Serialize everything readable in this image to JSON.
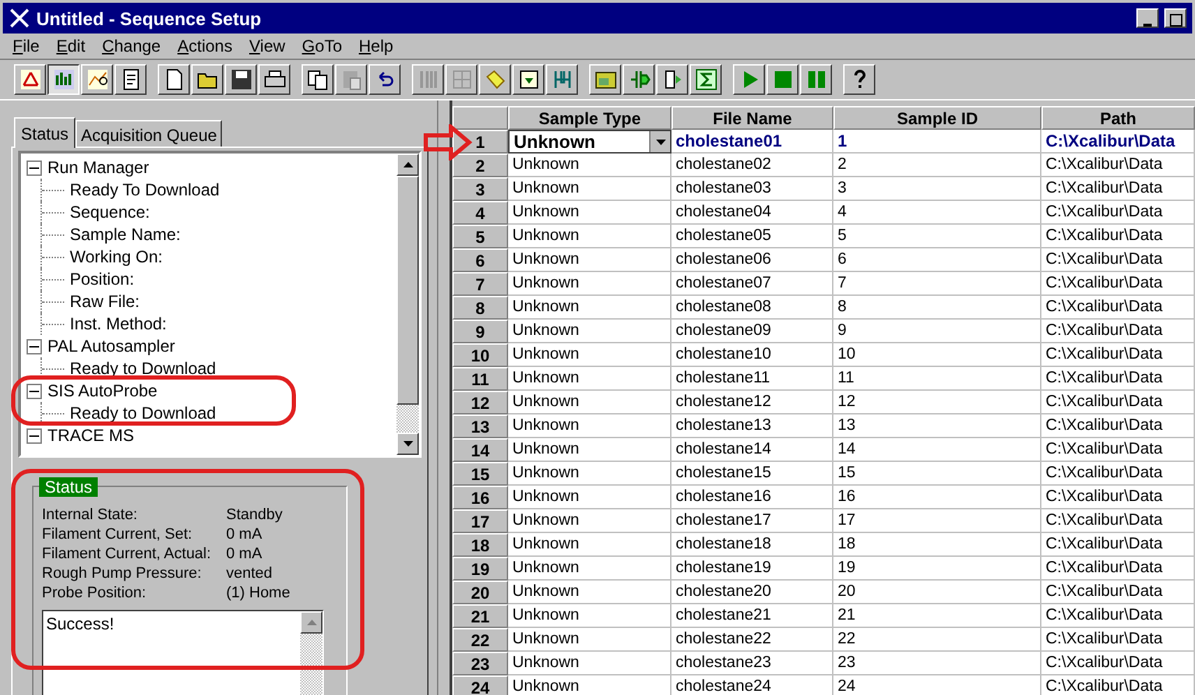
{
  "window": {
    "title": "Untitled - Sequence Setup"
  },
  "menu": [
    "File",
    "Edit",
    "Change",
    "Actions",
    "View",
    "GoTo",
    "Help"
  ],
  "toolbar": [
    [
      {
        "pressed": false
      },
      {
        "pressed": true
      },
      {
        "pressed": false
      },
      {
        "pressed": false
      }
    ],
    [
      {
        "disabled": false
      },
      {
        "disabled": false
      },
      {
        "disabled": false
      },
      {
        "disabled": false
      }
    ],
    [
      {
        "disabled": false
      },
      {
        "disabled": true
      },
      {
        "disabled": false
      }
    ],
    [
      {
        "disabled": true
      },
      {
        "disabled": true
      },
      {
        "disabled": false
      },
      {
        "disabled": false
      },
      {
        "disabled": false
      }
    ],
    [
      {
        "disabled": false
      },
      {
        "disabled": false
      },
      {
        "disabled": false
      },
      {
        "disabled": false
      }
    ],
    [
      {
        "disabled": false
      },
      {
        "disabled": false
      },
      {
        "disabled": false
      }
    ],
    [
      {
        "disabled": false
      }
    ]
  ],
  "tabs": [
    {
      "label": "Status",
      "selected": true
    },
    {
      "label": "Acquisition Queue",
      "selected": false
    }
  ],
  "tree": [
    {
      "label": "Run Manager",
      "expanded": true,
      "children": [
        {
          "label": "Ready To Download"
        },
        {
          "label": "Sequence:"
        },
        {
          "label": "Sample Name:"
        },
        {
          "label": "Working On:"
        },
        {
          "label": "Position:"
        },
        {
          "label": "Raw File:"
        },
        {
          "label": "Inst. Method:"
        }
      ]
    },
    {
      "label": "PAL Autosampler",
      "expanded": true,
      "children": [
        {
          "label": "Ready to Download"
        }
      ]
    },
    {
      "label": "SIS AutoProbe",
      "expanded": true,
      "highlighted": true,
      "children": [
        {
          "label": "Ready to Download"
        }
      ]
    },
    {
      "label": "TRACE MS",
      "expanded": true
    }
  ],
  "status": {
    "title": "Status",
    "highlighted": true,
    "fields": [
      {
        "label": "Internal State:",
        "value": "Standby"
      },
      {
        "label": "Filament Current, Set:",
        "value": "0 mA"
      },
      {
        "label": "Filament Current, Actual:",
        "value": "0 mA"
      },
      {
        "label": "Rough Pump Pressure:",
        "value": "vented"
      },
      {
        "label": "Probe Position:",
        "value": "(1) Home"
      }
    ],
    "message": "Success!"
  },
  "table": {
    "columns": [
      "Sample Type",
      "File Name",
      "Sample ID",
      "Path"
    ],
    "rows": [
      {
        "num": "1",
        "selected": true,
        "cells": [
          "Unknown",
          "cholestane01",
          "1",
          "C:\\Xcalibur\\Data"
        ]
      },
      {
        "num": "2",
        "selected": false,
        "cells": [
          "Unknown",
          "cholestane02",
          "2",
          "C:\\Xcalibur\\Data"
        ]
      },
      {
        "num": "3",
        "selected": false,
        "cells": [
          "Unknown",
          "cholestane03",
          "3",
          "C:\\Xcalibur\\Data"
        ]
      },
      {
        "num": "4",
        "selected": false,
        "cells": [
          "Unknown",
          "cholestane04",
          "4",
          "C:\\Xcalibur\\Data"
        ]
      },
      {
        "num": "5",
        "selected": false,
        "cells": [
          "Unknown",
          "cholestane05",
          "5",
          "C:\\Xcalibur\\Data"
        ]
      },
      {
        "num": "6",
        "selected": false,
        "cells": [
          "Unknown",
          "cholestane06",
          "6",
          "C:\\Xcalibur\\Data"
        ]
      },
      {
        "num": "7",
        "selected": false,
        "cells": [
          "Unknown",
          "cholestane07",
          "7",
          "C:\\Xcalibur\\Data"
        ]
      },
      {
        "num": "8",
        "selected": false,
        "cells": [
          "Unknown",
          "cholestane08",
          "8",
          "C:\\Xcalibur\\Data"
        ]
      },
      {
        "num": "9",
        "selected": false,
        "cells": [
          "Unknown",
          "cholestane09",
          "9",
          "C:\\Xcalibur\\Data"
        ]
      },
      {
        "num": "10",
        "selected": false,
        "cells": [
          "Unknown",
          "cholestane10",
          "10",
          "C:\\Xcalibur\\Data"
        ]
      },
      {
        "num": "11",
        "selected": false,
        "cells": [
          "Unknown",
          "cholestane11",
          "11",
          "C:\\Xcalibur\\Data"
        ]
      },
      {
        "num": "12",
        "selected": false,
        "cells": [
          "Unknown",
          "cholestane12",
          "12",
          "C:\\Xcalibur\\Data"
        ]
      },
      {
        "num": "13",
        "selected": false,
        "cells": [
          "Unknown",
          "cholestane13",
          "13",
          "C:\\Xcalibur\\Data"
        ]
      },
      {
        "num": "14",
        "selected": false,
        "cells": [
          "Unknown",
          "cholestane14",
          "14",
          "C:\\Xcalibur\\Data"
        ]
      },
      {
        "num": "15",
        "selected": false,
        "cells": [
          "Unknown",
          "cholestane15",
          "15",
          "C:\\Xcalibur\\Data"
        ]
      },
      {
        "num": "16",
        "selected": false,
        "cells": [
          "Unknown",
          "cholestane16",
          "16",
          "C:\\Xcalibur\\Data"
        ]
      },
      {
        "num": "17",
        "selected": false,
        "cells": [
          "Unknown",
          "cholestane17",
          "17",
          "C:\\Xcalibur\\Data"
        ]
      },
      {
        "num": "18",
        "selected": false,
        "cells": [
          "Unknown",
          "cholestane18",
          "18",
          "C:\\Xcalibur\\Data"
        ]
      },
      {
        "num": "19",
        "selected": false,
        "cells": [
          "Unknown",
          "cholestane19",
          "19",
          "C:\\Xcalibur\\Data"
        ]
      },
      {
        "num": "20",
        "selected": false,
        "cells": [
          "Unknown",
          "cholestane20",
          "20",
          "C:\\Xcalibur\\Data"
        ]
      },
      {
        "num": "21",
        "selected": false,
        "cells": [
          "Unknown",
          "cholestane21",
          "21",
          "C:\\Xcalibur\\Data"
        ]
      },
      {
        "num": "22",
        "selected": false,
        "cells": [
          "Unknown",
          "cholestane22",
          "22",
          "C:\\Xcalibur\\Data"
        ]
      },
      {
        "num": "23",
        "selected": false,
        "cells": [
          "Unknown",
          "cholestane23",
          "23",
          "C:\\Xcalibur\\Data"
        ]
      },
      {
        "num": "24",
        "selected": false,
        "cells": [
          "Unknown",
          "cholestane24",
          "24",
          "C:\\Xcalibur\\Data"
        ]
      }
    ]
  }
}
